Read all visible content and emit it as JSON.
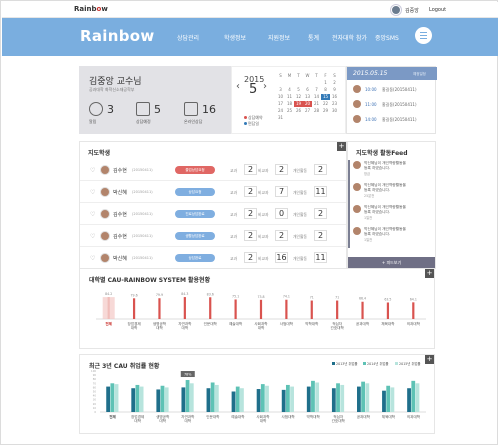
{
  "top": {
    "logo_pre": "Rainb",
    "logo_o": "o",
    "logo_post": "w",
    "user": "김중앙",
    "logout": "Logout"
  },
  "nav": {
    "logo": "Rainbow",
    "items": [
      "상담관리",
      "학생정보",
      "지원정보",
      "통계",
      "전자대학 참가",
      "중앙SMS"
    ]
  },
  "profile": {
    "name": "김중앙 교수님",
    "dept": "공과대학 화학신소재공학부",
    "stats": [
      {
        "value": "3",
        "label": "알림"
      },
      {
        "value": "5",
        "label": "상담예정"
      },
      {
        "value": "16",
        "label": "온라인상담"
      }
    ]
  },
  "calendar": {
    "year": "2015",
    "month": "5",
    "prev": "‹",
    "next": "›",
    "weekdays": [
      "S",
      "M",
      "T",
      "W",
      "T",
      "F",
      "S"
    ],
    "rows": [
      [
        "",
        "",
        "",
        "",
        "",
        "1",
        "2"
      ],
      [
        "3",
        "4",
        "5",
        "6",
        "7",
        "8",
        "9"
      ],
      [
        "10",
        "11",
        "12",
        "13",
        "14",
        "15",
        "16"
      ],
      [
        "17",
        "18",
        "19",
        "20",
        "21",
        "22",
        "23"
      ],
      [
        "24",
        "25",
        "26",
        "27",
        "28",
        "29",
        "30"
      ],
      [
        "31",
        "",
        "",
        "",
        "",
        "",
        ""
      ]
    ],
    "legend": [
      "상담예약",
      "면담일"
    ]
  },
  "schedule": {
    "date": "2015.05.15",
    "sub": "예정일정",
    "items": [
      {
        "time": "10:00",
        "name": "홍길동(20150411)"
      },
      {
        "time": "11:00",
        "name": "홍길동(20150411)"
      },
      {
        "time": "14:00",
        "name": "홍길동(20150411)"
      }
    ]
  },
  "students": {
    "title": "지도학생",
    "plus": "+",
    "keys": [
      "교과",
      "비교과",
      "개인활동"
    ],
    "rows": [
      {
        "name": "김수현",
        "id": "20150411",
        "tag": "졸업상담요청",
        "tag_color": "red",
        "v1": "2",
        "v2": "2",
        "v3": "2"
      },
      {
        "name": "박신혜",
        "id": "20150411",
        "tag": "상담요청",
        "tag_color": "blue",
        "v1": "2",
        "v2": "7",
        "v3": "11"
      },
      {
        "name": "김수현",
        "id": "20150411",
        "tag": "진로상담완료",
        "tag_color": "blue",
        "v1": "2",
        "v2": "0",
        "v3": "2"
      },
      {
        "name": "김수현",
        "id": "20150411",
        "tag": "생활상담완료",
        "tag_color": "blue",
        "v1": "2",
        "v2": "2",
        "v3": "2"
      },
      {
        "name": "박신혜",
        "id": "20150411",
        "tag": "상담완료",
        "tag_color": "blue",
        "v1": "2",
        "v2": "16",
        "v3": "11"
      }
    ]
  },
  "feed": {
    "title": "지도학생 활동Feed",
    "items": [
      {
        "l1": "박신혜님이 개인역량활동을",
        "l2": "등록 하였습니다.",
        "l3": "방금"
      },
      {
        "l1": "박신혜님이 개인역량활동을",
        "l2": "등록 하였습니다.",
        "l3": "25분전"
      },
      {
        "l1": "박신혜님이 개인역량활동을",
        "l2": "등록 하였습니다.",
        "l3": "1일전"
      },
      {
        "l1": "박신혜님이 개인역량활동을",
        "l2": "등록 하였습니다.",
        "l3": "1일전"
      }
    ],
    "more": "+ 피드보기"
  },
  "chart1": {
    "title": "대학별 CAU-RAINBOW SYSTEM 활용현황",
    "plus": "+"
  },
  "chart2": {
    "title": "최근 3년 CAU 취업률 현황",
    "plus": "+"
  },
  "colors": {
    "nav": "#7aaedf",
    "bar_single": "#e0706c",
    "s2013": "#1f6f8b",
    "s2014": "#5ec2b5",
    "s2015": "#b7e4dd"
  },
  "chart_data": [
    {
      "type": "bar",
      "title": "대학별 CAU-RAINBOW SYSTEM 활용현황",
      "categories": [
        "전체",
        "인문대학",
        "사회과학대학",
        "자연과학대학",
        "공과대학",
        "경영경제대학",
        "예술대학",
        "의과대학",
        "약학대학",
        "생명공학대학",
        "사범대학",
        "적십자간호대학"
      ],
      "display_labels": [
        [
          "전체"
        ],
        [
          "장업경제",
          "대학"
        ],
        [
          "생명공학",
          "대학"
        ],
        [
          "자연과학",
          "대학"
        ],
        [
          "인문대학"
        ],
        [
          "예술대학"
        ],
        [
          "사회과학",
          "대학"
        ],
        [
          "사범대학"
        ],
        [
          "약학대학"
        ],
        [
          "적십자",
          "간호대학"
        ],
        [
          "공과대학"
        ],
        [
          "체육대학"
        ],
        [
          "의과대학"
        ]
      ],
      "values": [
        84.2,
        79.6,
        79.9,
        84.3,
        83.6,
        75.1,
        73.8,
        74.1,
        71.0,
        71.0,
        66.4,
        63.5,
        64.1
      ],
      "ylim": [
        0,
        100
      ]
    },
    {
      "type": "bar",
      "title": "최근 3년 CAU 취업률 현황",
      "legend": [
        "2013년 취업률",
        "2014년 취업률",
        "2015년 취업률"
      ],
      "categories": [
        [
          "전체"
        ],
        [
          "장업경제",
          "대학"
        ],
        [
          "생명공학",
          "대학"
        ],
        [
          "자연과학",
          "대학"
        ],
        [
          "인문대학"
        ],
        [
          "예술대학"
        ],
        [
          "사회과학",
          "대학"
        ],
        [
          "사범대학"
        ],
        [
          "약학대학"
        ],
        [
          "적십자",
          "간호대학"
        ],
        [
          "공과대학"
        ],
        [
          "체육대학"
        ],
        [
          "의과대학"
        ]
      ],
      "yticks": [
        "100",
        "90",
        "80",
        "70",
        "60",
        "50",
        "40",
        "30",
        "20",
        "10",
        "0"
      ],
      "series": [
        {
          "name": "2013년 취업률",
          "values": [
            62,
            58,
            55,
            60,
            58,
            50,
            56,
            54,
            62,
            58,
            62,
            52,
            58
          ]
        },
        {
          "name": "2014년 취업률",
          "values": [
            70,
            66,
            64,
            78,
            72,
            62,
            68,
            66,
            76,
            70,
            74,
            64,
            76
          ]
        },
        {
          "name": "2015년 취업률",
          "values": [
            68,
            62,
            60,
            70,
            66,
            58,
            64,
            62,
            72,
            66,
            70,
            60,
            70
          ]
        }
      ],
      "highlight": {
        "index": 3,
        "label": "78%"
      },
      "ylim": [
        0,
        100
      ]
    }
  ]
}
